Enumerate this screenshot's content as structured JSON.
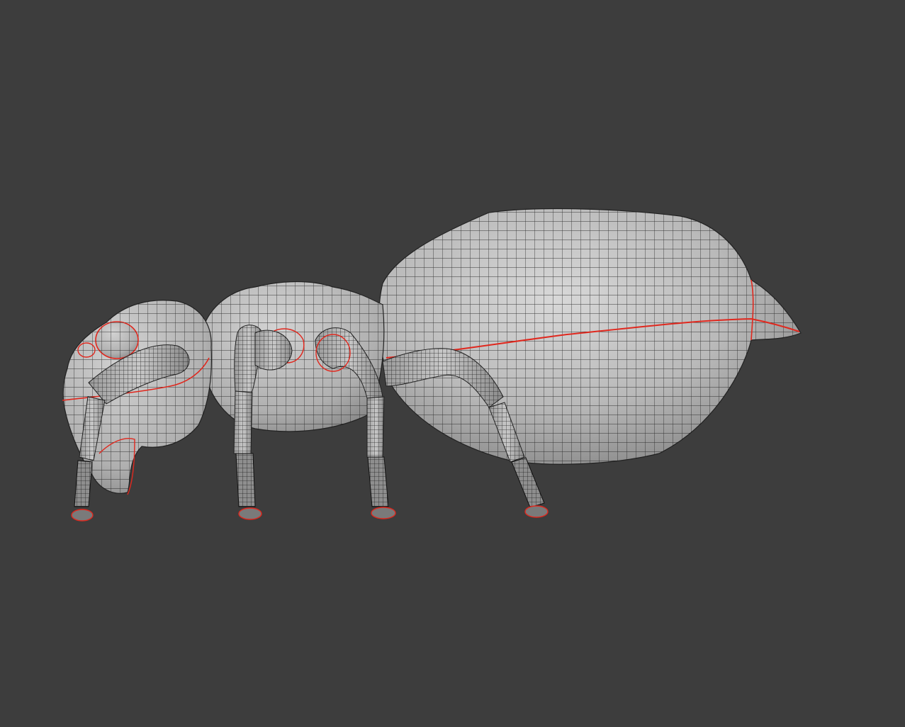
{
  "viewport": {
    "background": "#3d3d3d",
    "overlay": "wireframe",
    "seam_color": "#e0281e",
    "wire_color": "#1a1a1a",
    "mesh_base_color": "#bdbdbd"
  },
  "model": {
    "subject": "ant",
    "legs_visible": 4
  }
}
